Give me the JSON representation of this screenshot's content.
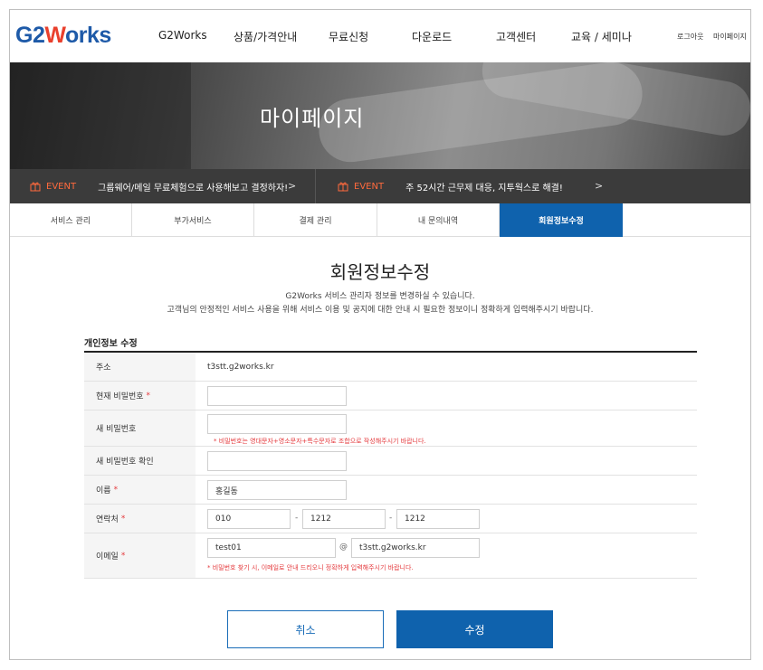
{
  "header": {
    "logo": {
      "part1": "G2",
      "part2": "W",
      "part3": "orks"
    },
    "nav": [
      "G2Works",
      "상품/가격안내",
      "무료신청",
      "다운로드",
      "고객센터",
      "교육 / 세미나"
    ],
    "util": {
      "logout": "로그아웃",
      "mypage": "마이페이지"
    }
  },
  "hero": {
    "title": "마이페이지"
  },
  "events": [
    {
      "tag": "EVENT",
      "text": "그룹웨어/메일 무료체험으로 사용해보고 결정하자!",
      "arrow": ">"
    },
    {
      "tag": "EVENT",
      "text": "주 52시간 근무제 대응, 지투웍스로 해결!",
      "arrow": ">"
    }
  ],
  "tabs": [
    "서비스 관리",
    "부가서비스",
    "결제 관리",
    "내 문의내역",
    "회원정보수정"
  ],
  "active_tab": 4,
  "page": {
    "title": "회원정보수정",
    "desc1": "G2Works 서비스 관리자 정보를 변경하실 수 있습니다.",
    "desc2": "고객님의 안정적인 서비스 사용을 위해 서비스 이용 및 공지에 대한 안내 시 필요한 정보이니 정확하게 입력해주시기 바랍니다.",
    "section_title": "개인정보 수정"
  },
  "form": {
    "address": {
      "label": "주소",
      "value": "t3stt.g2works.kr"
    },
    "current_password": {
      "label": "현재 비밀번호",
      "required": "*",
      "value": ""
    },
    "new_password": {
      "label": "새 비밀번호",
      "value": "",
      "hint": "* 비밀번호는 영대문자+영소문자+특수문자로 조합으로 작성해주시기 바랍니다."
    },
    "confirm_password": {
      "label": "새 비밀번호 확인",
      "value": ""
    },
    "name": {
      "label": "이름",
      "required": "*",
      "value": "홍길동"
    },
    "phone": {
      "label": "연락처",
      "required": "*",
      "part1": "010",
      "part2": "1212",
      "part3": "1212",
      "sep": "-"
    },
    "email": {
      "label": "이메일",
      "required": "*",
      "id": "test01",
      "at": "@",
      "domain": "t3stt.g2works.kr",
      "hint": "* 비밀번호 찾기 시, 이메일로 안내 드리오니 정확하게 입력해주시기 바랍니다."
    }
  },
  "buttons": {
    "cancel": "취소",
    "submit": "수정"
  },
  "colors": {
    "brand_blue": "#0f62ad",
    "logo_blue": "#1e5aa8",
    "logo_red": "#e9402d",
    "event_orange": "#ff6a3d",
    "required_red": "#e4393c",
    "event_bar": "#3b3b3b"
  }
}
